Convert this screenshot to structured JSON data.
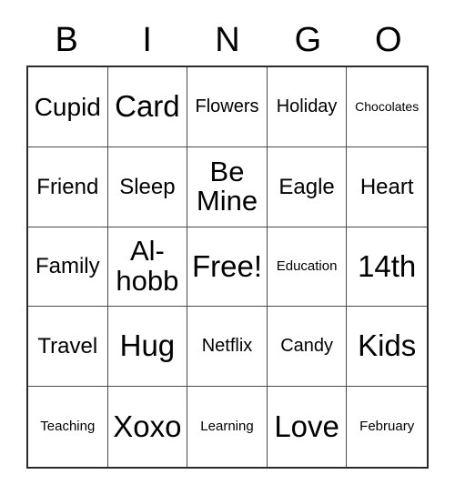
{
  "card": {
    "header_letters": [
      "B",
      "I",
      "N",
      "G",
      "O"
    ],
    "colors": {
      "background": "#ffffff",
      "text": "#000000",
      "grid_line": "#4a4a4a",
      "grid_outer_border": "#2b2b2b"
    },
    "rows": [
      [
        {
          "label": "Cupid",
          "size": "fs-xl"
        },
        {
          "label": "Card",
          "size": "fs-xxxl"
        },
        {
          "label": "Flowers",
          "size": "fs-m"
        },
        {
          "label": "Holiday",
          "size": "fs-m"
        },
        {
          "label": "Chocolates",
          "size": "fs-xs"
        }
      ],
      [
        {
          "label": "Friend",
          "size": "fs-l"
        },
        {
          "label": "Sleep",
          "size": "fs-l"
        },
        {
          "label": "Be Mine",
          "size": "fs-xxl"
        },
        {
          "label": "Eagle",
          "size": "fs-l"
        },
        {
          "label": "Heart",
          "size": "fs-l"
        }
      ],
      [
        {
          "label": "Family",
          "size": "fs-l"
        },
        {
          "label": "Al-hobb",
          "size": "fs-xxl"
        },
        {
          "label": "Free!",
          "size": "fs-xxxl"
        },
        {
          "label": "Education",
          "size": "fs-s"
        },
        {
          "label": "14th",
          "size": "fs-xxxl"
        }
      ],
      [
        {
          "label": "Travel",
          "size": "fs-l"
        },
        {
          "label": "Hug",
          "size": "fs-xxxl"
        },
        {
          "label": "Netflix",
          "size": "fs-m"
        },
        {
          "label": "Candy",
          "size": "fs-m"
        },
        {
          "label": "Kids",
          "size": "fs-xxxl"
        }
      ],
      [
        {
          "label": "Teaching",
          "size": "fs-s"
        },
        {
          "label": "Xoxo",
          "size": "fs-xxxl"
        },
        {
          "label": "Learning",
          "size": "fs-s"
        },
        {
          "label": "Love",
          "size": "fs-xxxl"
        },
        {
          "label": "February",
          "size": "fs-s"
        }
      ]
    ]
  }
}
